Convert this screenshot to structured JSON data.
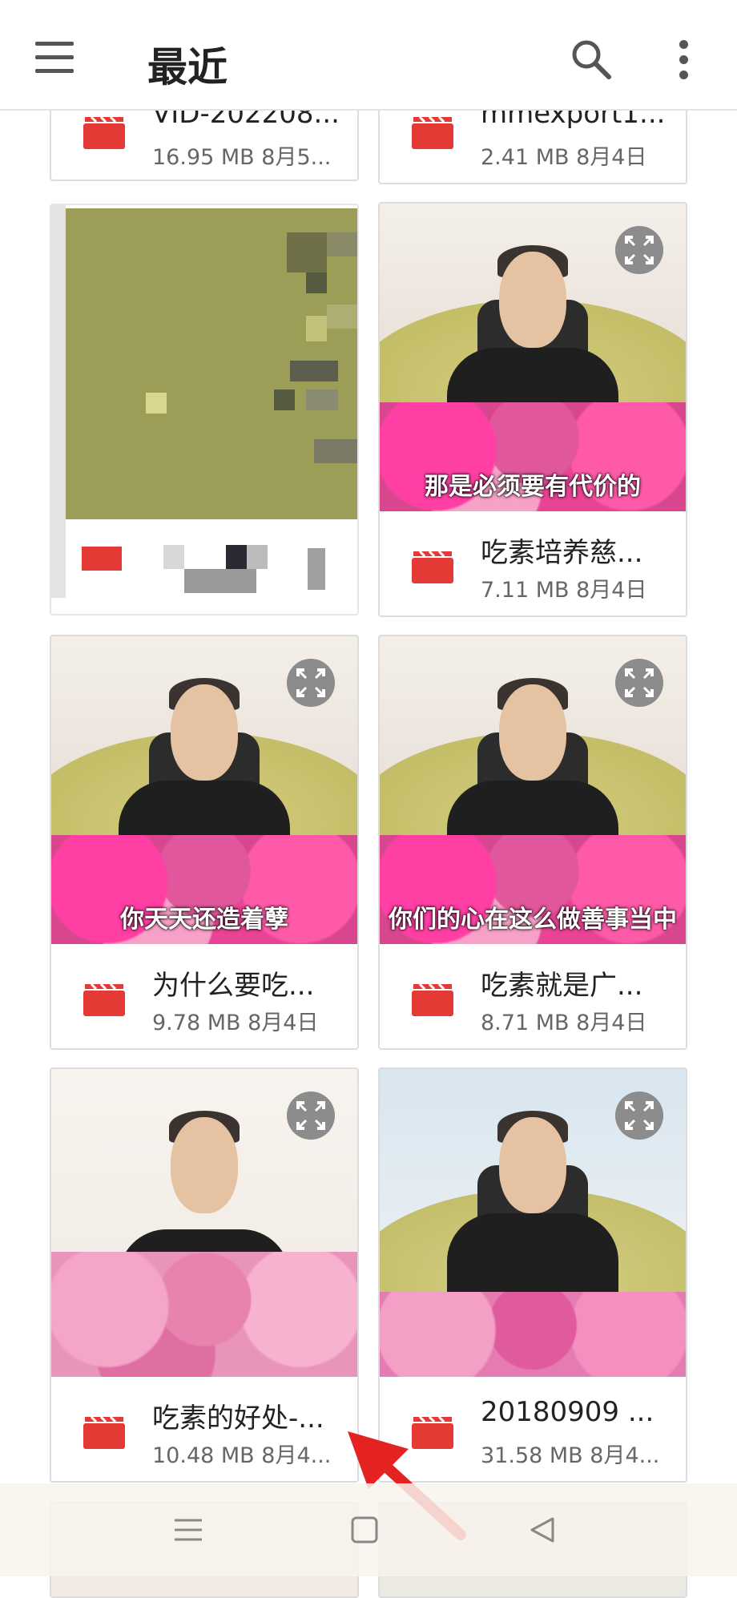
{
  "header": {
    "title": "最近"
  },
  "files": [
    {
      "name": "VID-202208...",
      "meta": "16.95 MB 8月5..."
    },
    {
      "name": "mmexport1...",
      "meta": "2.41 MB 8月4日"
    },
    {
      "name": "吃素培养慈...",
      "meta": "7.11 MB 8月4日",
      "subtitle": "那是必须要有代价的"
    },
    {
      "name": "为什么要吃...",
      "meta": "9.78 MB 8月4日",
      "subtitle": "你天天还造着孽"
    },
    {
      "name": "吃素就是广...",
      "meta": "8.71 MB 8月4日",
      "subtitle": "你们的心在这么做善事当中"
    },
    {
      "name": "吃素的好处-...",
      "meta": "10.48 MB 8月4..."
    },
    {
      "name": "20180909 ...",
      "meta": "31.58 MB 8月4..."
    }
  ],
  "colors": {
    "video_icon": "#e53935",
    "accent_arrow": "#e52222"
  },
  "icons": [
    "menu-icon",
    "search-icon",
    "more-vert-icon",
    "video-file-icon",
    "expand-icon",
    "nav-menu-icon",
    "nav-home-icon",
    "nav-back-icon"
  ]
}
